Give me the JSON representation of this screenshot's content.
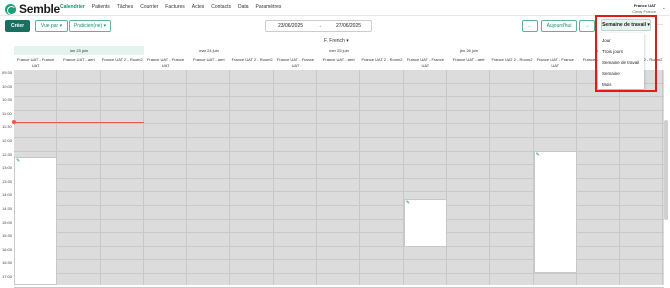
{
  "app": {
    "logo_text": "Semble",
    "nav": [
      "Calendrier",
      "Patients",
      "Tâches",
      "Courrier",
      "Factures",
      "Actes",
      "Contacts",
      "Data",
      "Paramètres"
    ],
    "active_nav": "Calendrier",
    "user_org": "France UAT",
    "user_name": "Cindy France"
  },
  "toolbar": {
    "create_label": "Créer",
    "view_by_label": "Vue par ▾",
    "practitioner_label": "Praticien(ne) ▾",
    "date_from": "23/06/2025",
    "date_sep": "→",
    "date_to": "27/06/2025",
    "prev_label": "←",
    "today_label": "Aujourd'hui",
    "next_label": "→",
    "view_selected": "Semaine de travail ▾",
    "more_label": "···"
  },
  "lang_selector": "F. French ▾",
  "calendar": {
    "days": [
      "lun 23 juin",
      "mar 24 juin",
      "mer 25 juin",
      "jeu 26 juin",
      "ve"
    ],
    "resources": [
      "France UAT - France UAT",
      "France UAT - aert",
      "France UAT 2 - Room2"
    ],
    "times": [
      "09:30",
      "10:00",
      "10:30",
      "11:00",
      "11:30",
      "12:00",
      "12:30",
      "13:00",
      "13:30",
      "14:00",
      "14:30",
      "15:00",
      "15:30",
      "16:00",
      "16:30",
      "17:00"
    ]
  },
  "view_dropdown": {
    "options": [
      "Jour",
      "Trois jours",
      "Semaine de travail",
      "Semaine",
      "Mois"
    ]
  },
  "colors": {
    "brand": "#1a8f6e",
    "highlight_box": "#e01b1b"
  }
}
